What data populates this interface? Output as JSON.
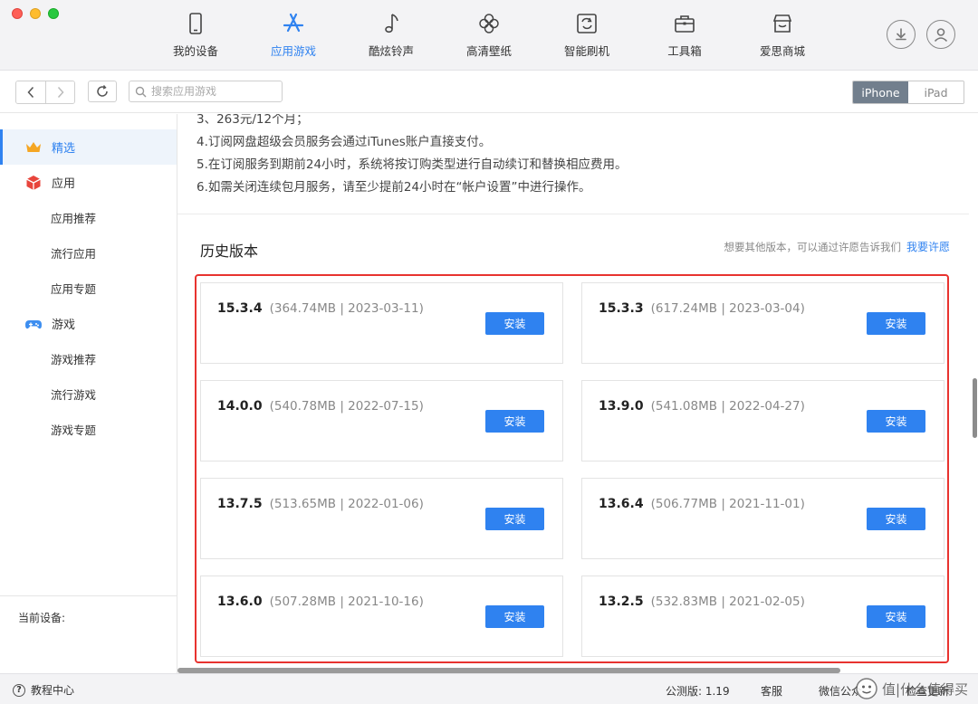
{
  "nav": {
    "items": [
      {
        "label": "我的设备",
        "icon": "phone-icon"
      },
      {
        "label": "应用游戏",
        "icon": "app-store-icon",
        "active": true
      },
      {
        "label": "酷炫铃声",
        "icon": "music-note-icon"
      },
      {
        "label": "高清壁纸",
        "icon": "flower-icon"
      },
      {
        "label": "智能刷机",
        "icon": "flash-icon"
      },
      {
        "label": "工具箱",
        "icon": "toolbox-icon"
      },
      {
        "label": "爱思商城",
        "icon": "store-icon"
      }
    ],
    "active_color": "#2f82f0"
  },
  "toolbar": {
    "search_placeholder": "搜索应用游戏",
    "device_toggle": {
      "iphone": "iPhone",
      "ipad": "iPad",
      "selected": "iPhone"
    }
  },
  "sidebar": {
    "featured": "精选",
    "apps": "应用",
    "app_recommend": "应用推荐",
    "app_popular": "流行应用",
    "app_topics": "应用专题",
    "games": "游戏",
    "game_recommend": "游戏推荐",
    "game_popular": "流行游戏",
    "game_topics": "游戏专题",
    "current_device": "当前设备:"
  },
  "content": {
    "desc_lines": [
      "3、263元/12个月；",
      "4.订阅网盘超级会员服务会通过iTunes账户直接支付。",
      "5.在订阅服务到期前24小时，系统将按订购类型进行自动续订和替换相应费用。",
      "6.如需关闭连续包月服务，请至少提前24小时在“帐户设置”中进行操作。"
    ],
    "history_title": "历史版本",
    "history_hint": "想要其他版本，可以通过许愿告诉我们",
    "history_link": "我要许愿",
    "install_label": "安装",
    "versions": [
      {
        "version": "15.3.4",
        "meta": "(364.74MB | 2023-03-11)"
      },
      {
        "version": "15.3.3",
        "meta": "(617.24MB | 2023-03-04)"
      },
      {
        "version": "14.0.0",
        "meta": "(540.78MB | 2022-07-15)"
      },
      {
        "version": "13.9.0",
        "meta": "(541.08MB | 2022-04-27)"
      },
      {
        "version": "13.7.5",
        "meta": "(513.65MB | 2022-01-06)"
      },
      {
        "version": "13.6.4",
        "meta": "(506.77MB | 2021-11-01)"
      },
      {
        "version": "13.6.0",
        "meta": "(507.28MB | 2021-10-16)"
      },
      {
        "version": "13.2.5",
        "meta": "(532.83MB | 2021-02-05)"
      }
    ],
    "highlight_color": "#e8332f"
  },
  "statusbar": {
    "tutorial": "教程中心",
    "version": "公测版: 1.19",
    "service": "客服",
    "wechat": "微信公众",
    "update": "检查更新",
    "watermark": "值|什么值得买"
  }
}
